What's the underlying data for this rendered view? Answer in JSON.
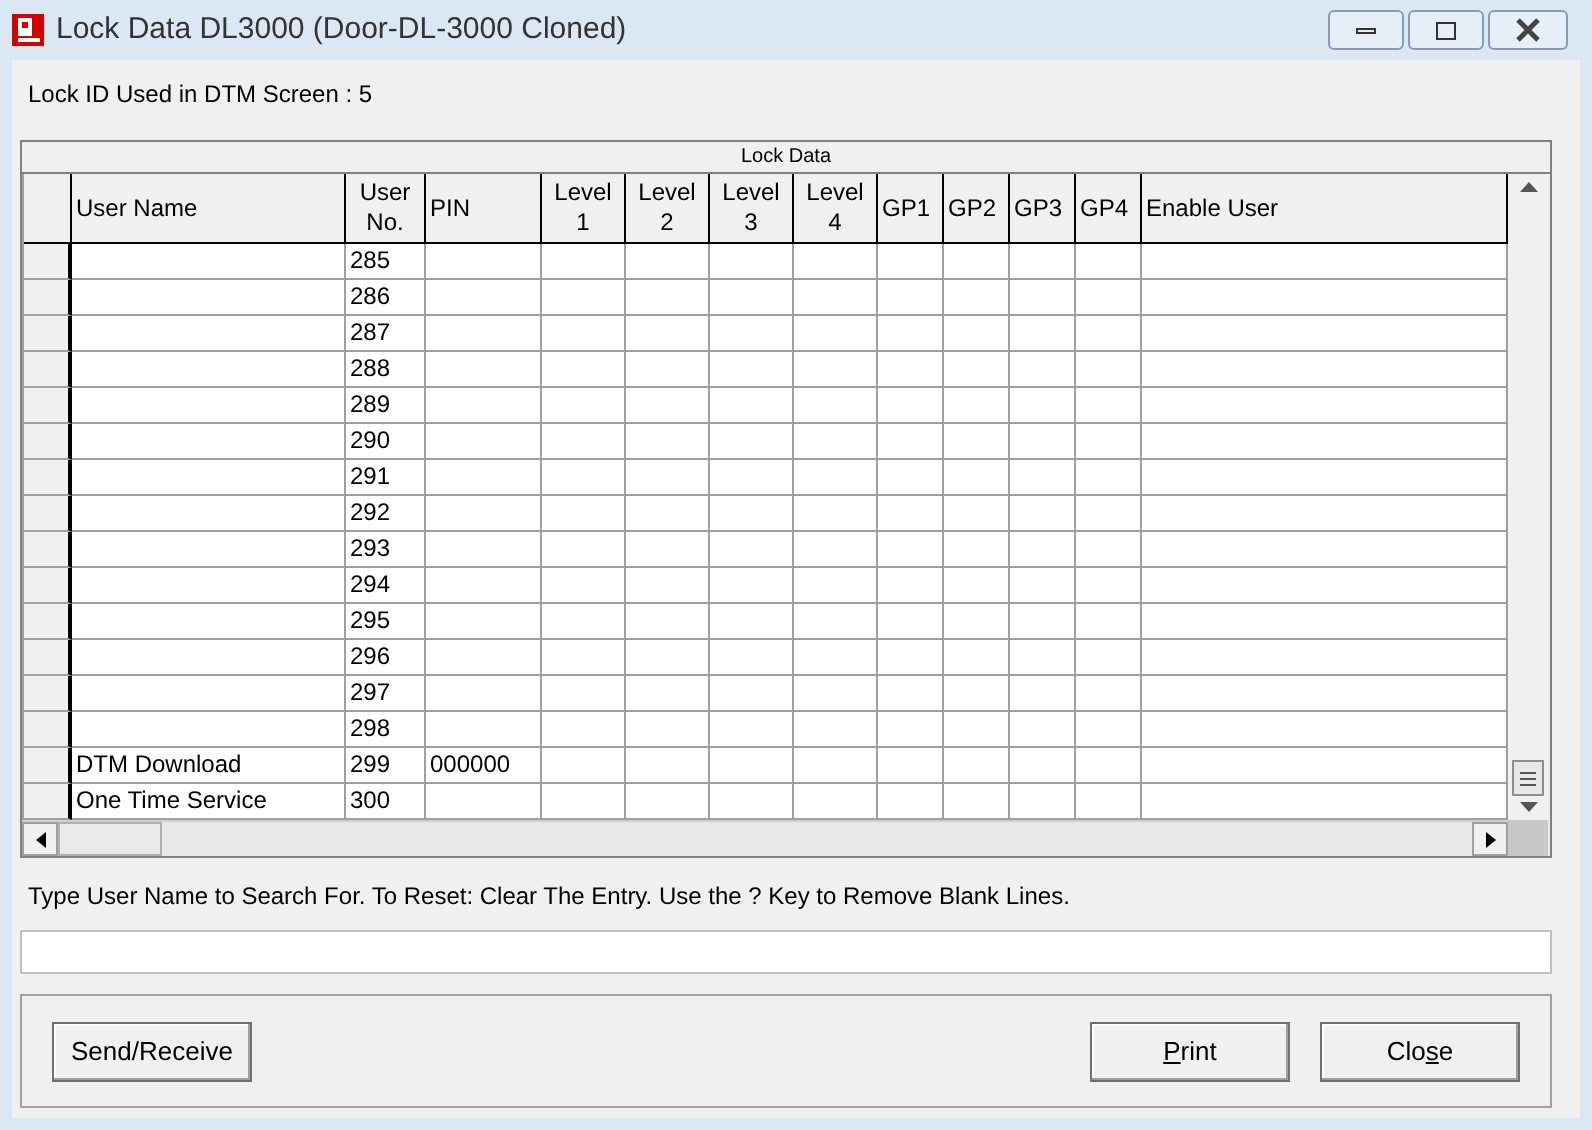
{
  "window": {
    "title": "Lock Data DL3000 (Door-DL-3000 Cloned)"
  },
  "lock_id_label": "Lock ID Used in DTM Screen : 5",
  "grid": {
    "caption": "Lock Data",
    "columns": [
      {
        "lines": [
          "User Name"
        ]
      },
      {
        "lines": [
          "User",
          "No."
        ]
      },
      {
        "lines": [
          "PIN"
        ]
      },
      {
        "lines": [
          "Level",
          "1"
        ]
      },
      {
        "lines": [
          "Level",
          "2"
        ]
      },
      {
        "lines": [
          "Level",
          "3"
        ]
      },
      {
        "lines": [
          "Level",
          "4"
        ]
      },
      {
        "lines": [
          "GP1"
        ]
      },
      {
        "lines": [
          "GP2"
        ]
      },
      {
        "lines": [
          "GP3"
        ]
      },
      {
        "lines": [
          "GP4"
        ]
      },
      {
        "lines": [
          "Enable User"
        ]
      }
    ],
    "rows": [
      {
        "user_no": "285"
      },
      {
        "user_no": "286"
      },
      {
        "user_no": "287"
      },
      {
        "user_no": "288"
      },
      {
        "user_no": "289"
      },
      {
        "user_no": "290"
      },
      {
        "user_no": "291"
      },
      {
        "user_no": "292"
      },
      {
        "user_no": "293"
      },
      {
        "user_no": "294"
      },
      {
        "user_no": "295"
      },
      {
        "user_no": "296"
      },
      {
        "user_no": "297"
      },
      {
        "user_no": "298"
      },
      {
        "user_name": "DTM Download",
        "user_no": "299",
        "pin": "000000"
      },
      {
        "user_name": "One Time Service",
        "user_no": "300"
      }
    ]
  },
  "search_hint": "Type User Name to Search For. To Reset: Clear The Entry. Use the ? Key to Remove Blank Lines.",
  "left_buttons": [
    {
      "label": "Send/Receive"
    }
  ],
  "right_buttons": [
    {
      "label_parts": [
        {
          "text": "P",
          "underline": true
        },
        {
          "text": "rint",
          "underline": false
        }
      ]
    },
    {
      "label_parts": [
        {
          "text": "Clo",
          "underline": false
        },
        {
          "text": "s",
          "underline": true
        },
        {
          "text": "e",
          "underline": false
        }
      ]
    }
  ]
}
